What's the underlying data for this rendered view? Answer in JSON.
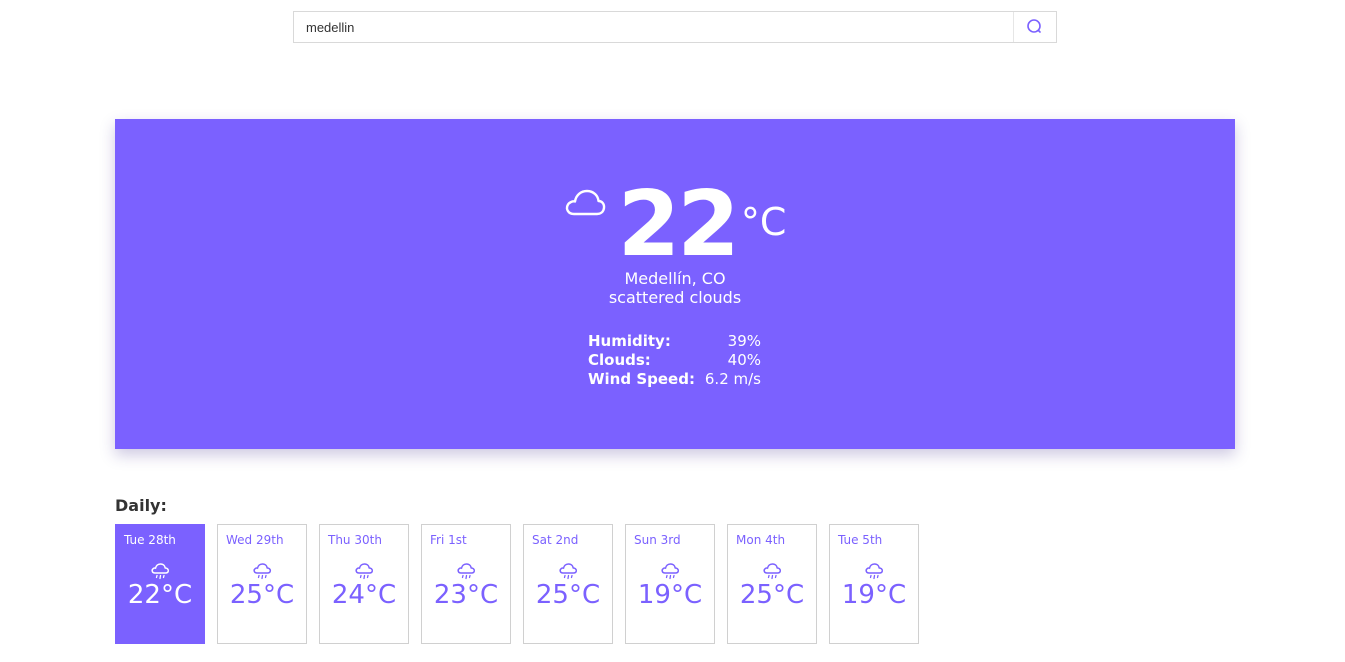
{
  "search": {
    "value": "medellin",
    "icon": "search-icon"
  },
  "current": {
    "icon": "cloud-icon",
    "temperature": "22",
    "unit": "°C",
    "city": "Medellín, CO",
    "description": "scattered clouds",
    "stats": [
      {
        "label": "Humidity:",
        "value": "39%"
      },
      {
        "label": "Clouds:",
        "value": "40%"
      },
      {
        "label": "Wind Speed:",
        "value": "6.2 m/s"
      }
    ]
  },
  "daily": {
    "title": "Daily:",
    "icon": "rain-cloud-icon",
    "days": [
      {
        "label": "Tue 28th",
        "temp": "22°C"
      },
      {
        "label": "Wed 29th",
        "temp": "25°C"
      },
      {
        "label": "Thu 30th",
        "temp": "24°C"
      },
      {
        "label": "Fri 1st",
        "temp": "23°C"
      },
      {
        "label": "Sat 2nd",
        "temp": "25°C"
      },
      {
        "label": "Sun 3rd",
        "temp": "19°C"
      },
      {
        "label": "Mon 4th",
        "temp": "25°C"
      },
      {
        "label": "Tue 5th",
        "temp": "19°C"
      }
    ]
  },
  "colors": {
    "accent": "#7b61ff",
    "card_text": "#ffffff",
    "border": "#d0d0d0"
  }
}
